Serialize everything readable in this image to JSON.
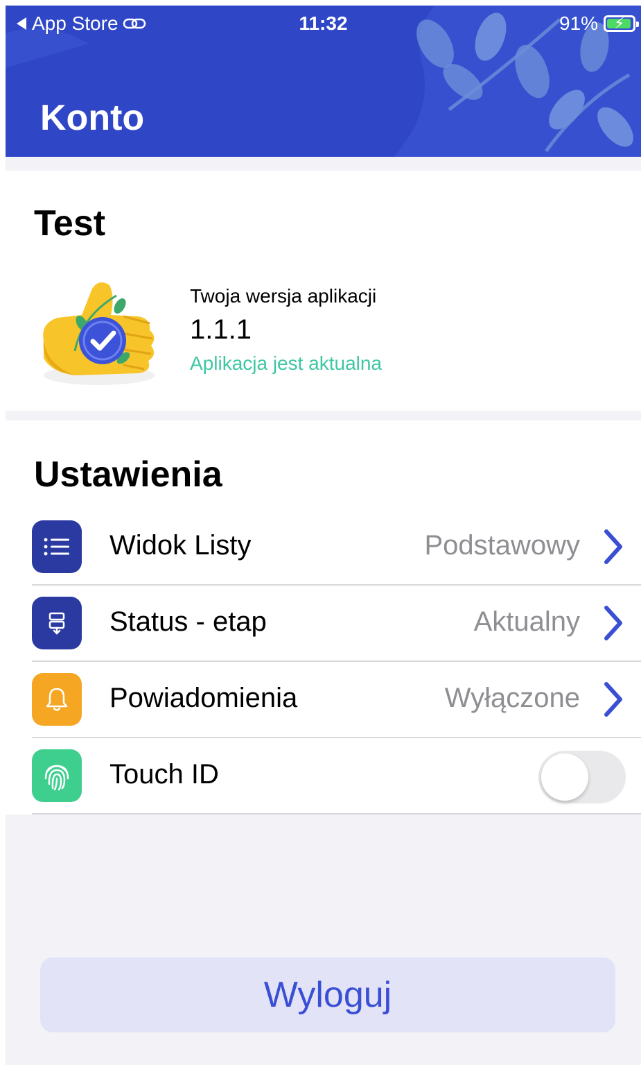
{
  "status_bar": {
    "back_label": "App Store",
    "time": "11:32",
    "battery": "91%"
  },
  "header": {
    "title": "Konto",
    "accent": "#2f46c6"
  },
  "app_card": {
    "title": "Test",
    "version_label": "Twoja wersja aplikacji",
    "version": "1.1.1",
    "status": "Aplikacja jest aktualna",
    "status_color": "#3ec7a2"
  },
  "settings": {
    "title": "Ustawienia",
    "items": [
      {
        "label": "Widok Listy",
        "value": "Podstawowy",
        "icon": "list-icon",
        "icon_color": "#2b3aa0"
      },
      {
        "label": "Status - etap",
        "value": "Aktualny",
        "icon": "status-icon",
        "icon_color": "#2b3aa0"
      },
      {
        "label": "Powiadomienia",
        "value": "Wyłączone",
        "icon": "bell-icon",
        "icon_color": "#f5a623"
      },
      {
        "label": "Touch ID",
        "value": "",
        "icon": "fingerprint-icon",
        "icon_color": "#3ecf8e",
        "toggle_on": false
      }
    ]
  },
  "logout": {
    "label": "Wyloguj"
  }
}
